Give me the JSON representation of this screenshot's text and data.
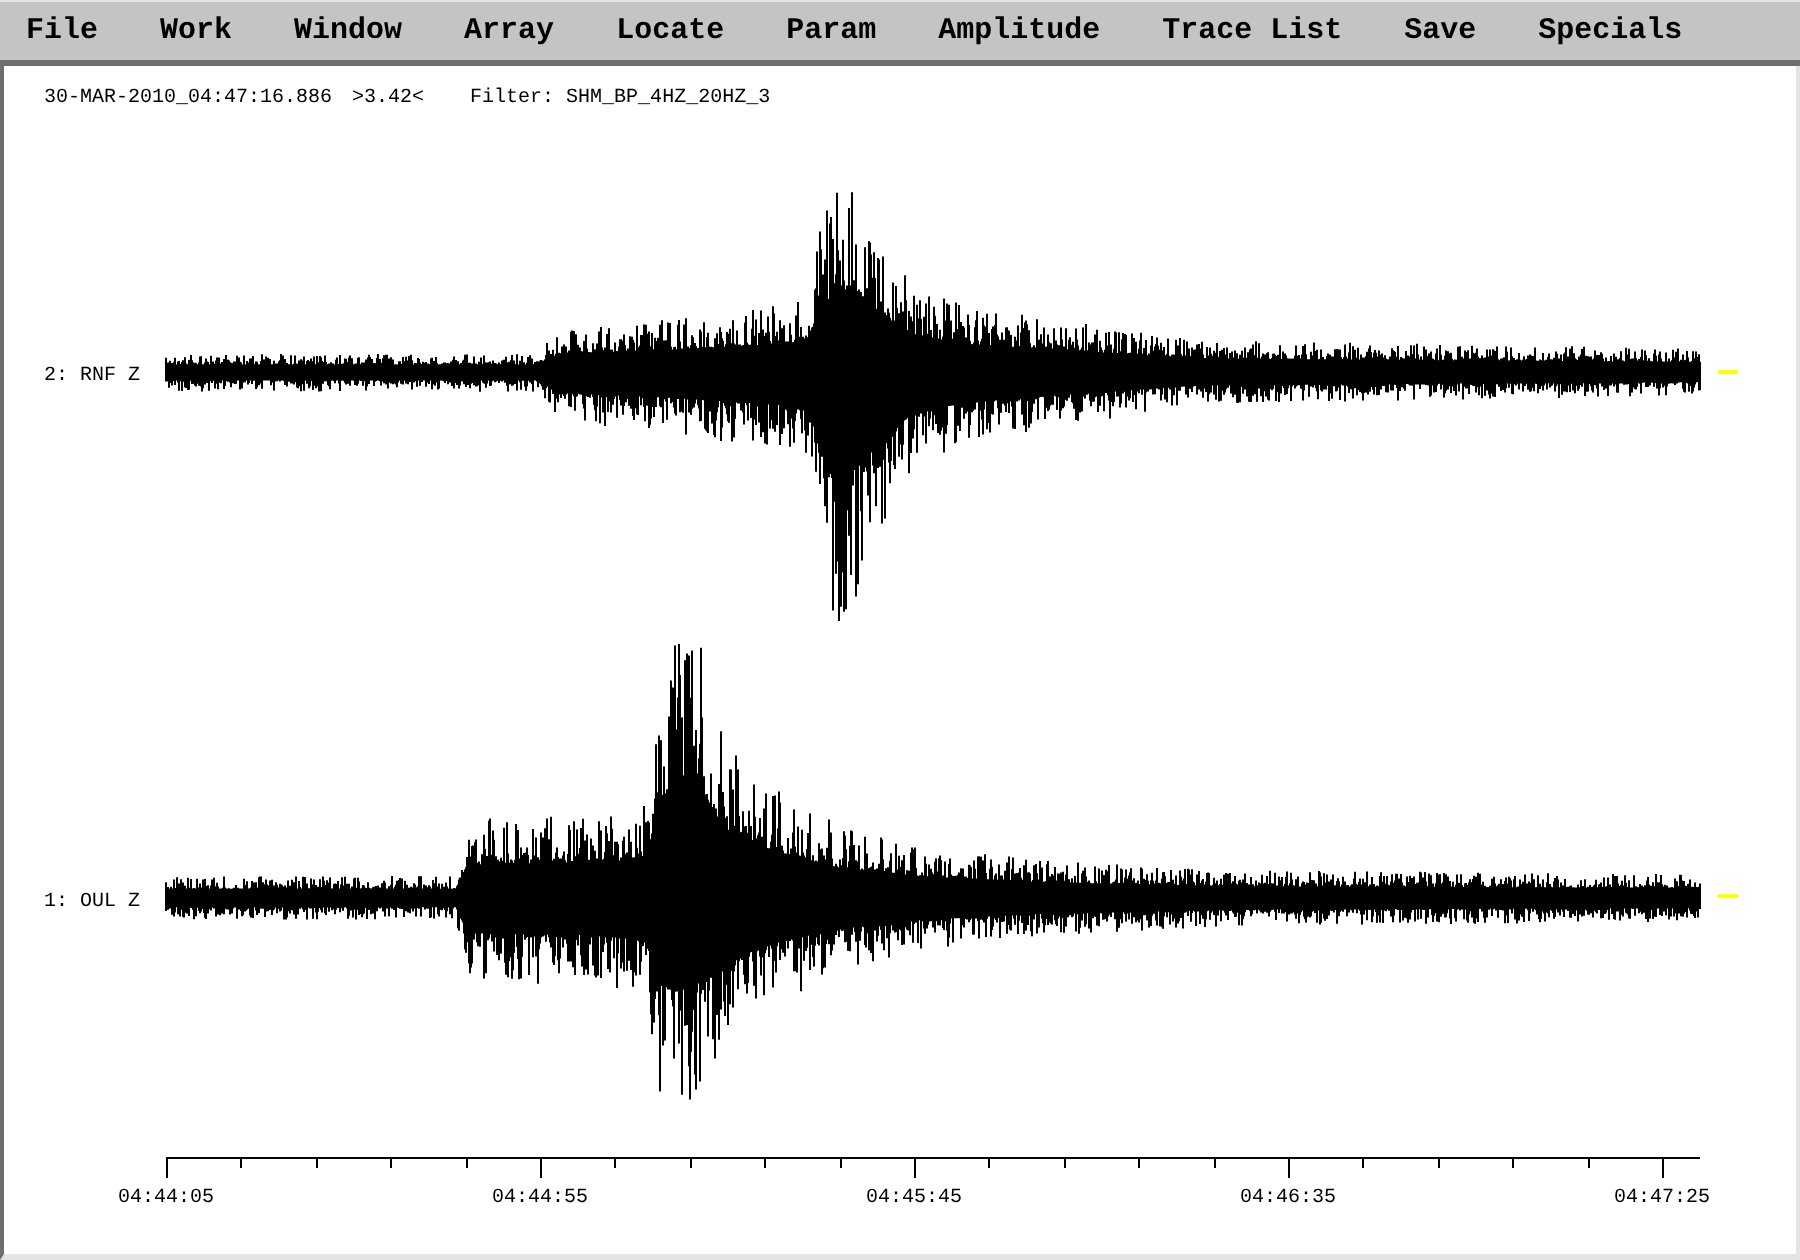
{
  "menu": [
    "File",
    "Work",
    "Window",
    "Array",
    "Locate",
    "Param",
    "Amplitude",
    "Trace List",
    "Save",
    "Specials"
  ],
  "info": {
    "timestamp": "30-MAR-2010_04:47:16.886",
    "reading": ">3.42<",
    "filter": "Filter: SHM_BP_4HZ_20HZ_3"
  },
  "traces": [
    {
      "label": "2: RNF Z",
      "color": "#ffff00"
    },
    {
      "label": "1: OUL Z",
      "color": "#ffff00"
    }
  ],
  "time_axis": {
    "labels": [
      "04:44:05",
      "04:44:55",
      "04:45:45",
      "04:46:35",
      "04:47:25"
    ]
  }
}
